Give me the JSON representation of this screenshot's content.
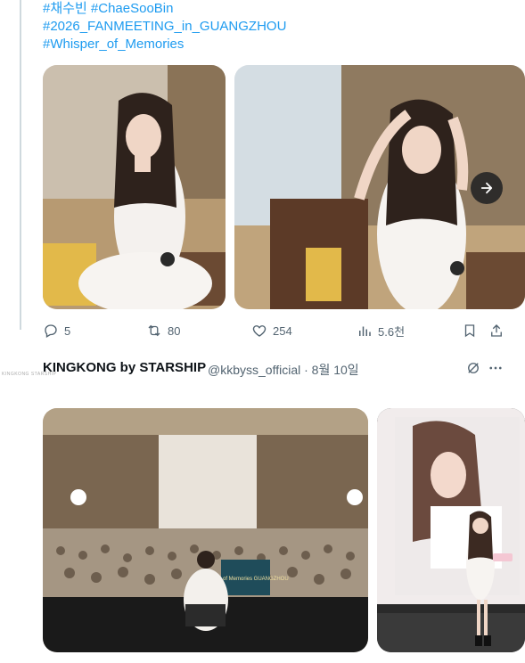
{
  "tweet1": {
    "hashtags": [
      "#채수빈 #ChaeSooBin",
      "#2026_FANMEETING_in_GUANGZHOU",
      "#Whisper_of_Memories"
    ],
    "actions": {
      "reply_count": "5",
      "retweet_count": "80",
      "like_count": "254",
      "views_count": "5.6천"
    }
  },
  "tweet2": {
    "author_name": "KINGKONG by STARSHIP",
    "author_handle_date": "@kkbyss_official · 8월 10일",
    "avatar_text": "KINGKONG STARSHIP",
    "banner_text": "Whisper of Memories GUANGZHOU"
  },
  "icons": {
    "reply": "reply-icon",
    "retweet": "retweet-icon",
    "like": "heart-icon",
    "views": "views-icon",
    "bookmark": "bookmark-icon",
    "share": "share-icon",
    "next": "arrow-right-icon",
    "grok": "grok-icon",
    "more": "more-icon"
  },
  "colors": {
    "link": "#1d9bf0",
    "muted": "#536471",
    "thread_line": "#cfd9de"
  }
}
